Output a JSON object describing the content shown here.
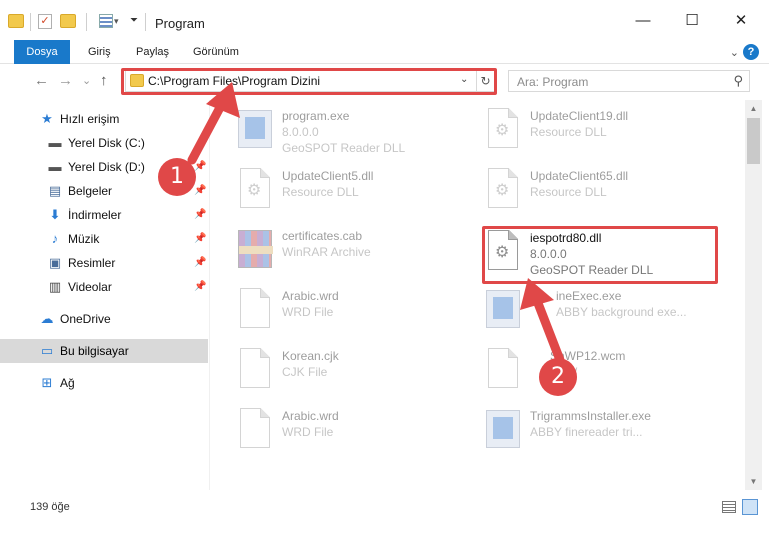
{
  "window": {
    "title": "Program",
    "minimize_glyph": "—",
    "maximize_glyph": "☐",
    "close_glyph": "✕"
  },
  "ribbon": {
    "tabs": [
      "Dosya",
      "Giriş",
      "Paylaş",
      "Görünüm"
    ],
    "help": "?"
  },
  "nav": {
    "back": "←",
    "forward": "→",
    "recent": "⌄",
    "up": "↑",
    "address": "C:\\Program Files\\Program Dizini",
    "refresh": "↻",
    "search_placeholder": "Ara: Program"
  },
  "sidebar": {
    "items": [
      {
        "label": "Hızlı erişim",
        "icon": "star-icon"
      },
      {
        "label": "Yerel Disk (C:)",
        "icon": "drive-icon"
      },
      {
        "label": "Yerel Disk (D:)",
        "icon": "drive-icon"
      },
      {
        "label": "Belgeler",
        "icon": "documents-icon"
      },
      {
        "label": "İndirmeler",
        "icon": "download-icon"
      },
      {
        "label": "Müzik",
        "icon": "music-icon"
      },
      {
        "label": "Resimler",
        "icon": "pictures-icon"
      },
      {
        "label": "Videolar",
        "icon": "videos-icon"
      },
      {
        "label": "OneDrive",
        "icon": "cloud-icon"
      },
      {
        "label": "Bu bilgisayar",
        "icon": "computer-icon"
      },
      {
        "label": "Ağ",
        "icon": "network-icon"
      }
    ]
  },
  "files": [
    {
      "name": "program.exe",
      "line1": "8.0.0.0",
      "line2": "GeoSPOT Reader DLL",
      "icon": "exe-icon"
    },
    {
      "name": "UpdateClient19.dll",
      "line1": "Resource DLL",
      "line2": "",
      "icon": "dll-icon"
    },
    {
      "name": "UpdateClient5.dll",
      "line1": "Resource DLL",
      "line2": "",
      "icon": "dll-icon"
    },
    {
      "name": "UpdateClient65.dll",
      "line1": "Resource DLL",
      "line2": "",
      "icon": "dll-icon"
    },
    {
      "name": "certificates.cab",
      "line1": "WinRAR Archive",
      "line2": "",
      "icon": "winrar-icon"
    },
    {
      "name": "iespotrd80.dll",
      "line1": "8.0.0.0",
      "line2": "GeoSPOT Reader DLL",
      "icon": "dll-icon"
    },
    {
      "name": "Arabic.wrd",
      "line1": "WRD File",
      "line2": "",
      "icon": "file-icon"
    },
    {
      "name": "ineExec.exe",
      "line1": "ABBY background exe...",
      "line2": "",
      "icon": "exe-icon"
    },
    {
      "name": "Korean.cjk",
      "line1": "CJK File",
      "line2": "",
      "icon": "file-icon"
    },
    {
      "name": "SnWP12.wcm",
      "line1": "W",
      "line2": "",
      "icon": "file-icon"
    },
    {
      "name": "Arabic.wrd",
      "line1": "WRD File",
      "line2": "",
      "icon": "file-icon"
    },
    {
      "name": "TrigrammsInstaller.exe",
      "line1": "ABBY finereader tri...",
      "line2": "",
      "icon": "exe-icon"
    }
  ],
  "status": {
    "count": "139 öğe"
  },
  "annotations": {
    "badge1": "1",
    "badge2": "2",
    "color": "#e04848"
  }
}
